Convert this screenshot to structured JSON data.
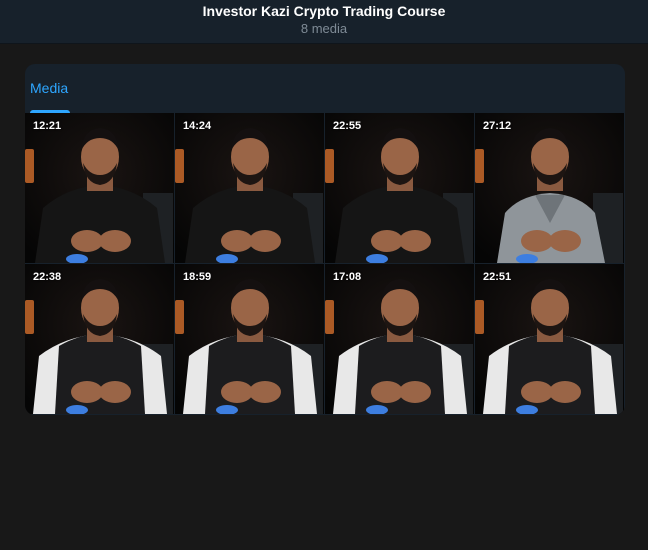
{
  "header": {
    "title": "Investor Kazi Crypto Trading Course",
    "subtitle": "8 media"
  },
  "tabs": [
    {
      "label": "Media",
      "active": true
    }
  ],
  "media": [
    {
      "duration": "12:21",
      "shirt": "black"
    },
    {
      "duration": "14:24",
      "shirt": "black"
    },
    {
      "duration": "22:55",
      "shirt": "black"
    },
    {
      "duration": "27:12",
      "shirt": "grey"
    },
    {
      "duration": "22:38",
      "shirt": "vest"
    },
    {
      "duration": "18:59",
      "shirt": "vest"
    },
    {
      "duration": "17:08",
      "shirt": "vest"
    },
    {
      "duration": "22:51",
      "shirt": "vest"
    }
  ],
  "colors": {
    "accent": "#2ea6ff",
    "header_bg": "#17212b",
    "page_bg": "#181818"
  }
}
